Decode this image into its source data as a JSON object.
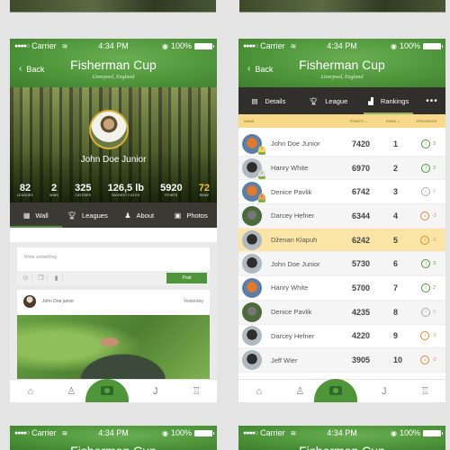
{
  "status_bar": {
    "signal": "●●●●○",
    "carrier": "Carrier",
    "time": "4:34 PM",
    "battery": "100%"
  },
  "header": {
    "back_label": "Back",
    "title": "Fisherman Cup",
    "subtitle": "Liverpool, England"
  },
  "profile": {
    "name": "John Doe Junior",
    "stats": [
      {
        "value": "82",
        "label": "LEAGUES"
      },
      {
        "value": "2",
        "label": "WINS"
      },
      {
        "value": "325",
        "label": "CATCHES"
      },
      {
        "value": "126,5 lb",
        "label": "BIGGEST CATCH"
      },
      {
        "value": "5920",
        "label": "POINTS"
      },
      {
        "value": "72",
        "label": "RANK"
      }
    ],
    "tabs": [
      {
        "label": "Wall",
        "icon": "calendar-icon",
        "active": true
      },
      {
        "label": "Leagues",
        "icon": "trophy-icon",
        "active": false
      },
      {
        "label": "About",
        "icon": "person-icon",
        "active": false
      },
      {
        "label": "Photos",
        "icon": "image-icon",
        "active": false
      }
    ]
  },
  "composer": {
    "placeholder": "Write something",
    "post_label": "Post",
    "icons": [
      "location-icon",
      "attach-icon",
      "video-icon"
    ]
  },
  "post": {
    "author": "John Doe junior",
    "time": "Yesterday"
  },
  "tabbar": {
    "items": [
      "home-icon",
      "profile-icon",
      "camera-icon",
      "hook-icon",
      "trophy-icon"
    ]
  },
  "league": {
    "tabs": [
      {
        "label": "Details",
        "icon": "details-icon",
        "active": false
      },
      {
        "label": "League",
        "icon": "trophy-icon",
        "active": false
      },
      {
        "label": "Rankings",
        "icon": "bar-chart-icon",
        "active": true
      },
      {
        "label": "•••",
        "icon": "more-icon",
        "active": false
      }
    ],
    "columns": {
      "name": "NAME",
      "points": "POINTS",
      "rank": "RANK",
      "progress": "PROGRESS"
    },
    "rows": [
      {
        "name": "John Doe Junior",
        "points": "7420",
        "rank": "1",
        "progress": "3",
        "trend": "up",
        "medal": "gold",
        "highlight": false
      },
      {
        "name": "Hanry White",
        "points": "6970",
        "rank": "2",
        "progress": "2",
        "trend": "up",
        "medal": "silver",
        "highlight": false
      },
      {
        "name": "Denice Pavlik",
        "points": "6742",
        "rank": "3",
        "progress": "0",
        "trend": "same",
        "medal": "bronze",
        "highlight": false
      },
      {
        "name": "Darcey Hefner",
        "points": "6344",
        "rank": "4",
        "progress": "-3",
        "trend": "down",
        "medal": "",
        "highlight": false
      },
      {
        "name": "Dženan Klapuh",
        "points": "6242",
        "rank": "5",
        "progress": "-2",
        "trend": "down",
        "medal": "",
        "highlight": true
      },
      {
        "name": "John Doe Junior",
        "points": "5730",
        "rank": "6",
        "progress": "3",
        "trend": "up",
        "medal": "",
        "highlight": false
      },
      {
        "name": "Hanry White",
        "points": "5700",
        "rank": "7",
        "progress": "2",
        "trend": "up",
        "medal": "",
        "highlight": false
      },
      {
        "name": "Denice Pavlik",
        "points": "4235",
        "rank": "8",
        "progress": "0",
        "trend": "same",
        "medal": "",
        "highlight": false
      },
      {
        "name": "Darcey Hefner",
        "points": "4220",
        "rank": "9",
        "progress": "-3",
        "trend": "down",
        "medal": "",
        "highlight": false
      },
      {
        "name": "Jeff Wier",
        "points": "3905",
        "rank": "10",
        "progress": "-2",
        "trend": "down",
        "medal": "",
        "highlight": false
      }
    ]
  },
  "colors": {
    "brand_green": "#4f963b",
    "rank_gold": "#f2c12e",
    "header_yellow": "#f8d98a",
    "highlight_row": "#fbe5a6",
    "trend_up": "#4f963b",
    "trend_down": "#e08a2c",
    "dark_tabs": "#302f2b"
  }
}
